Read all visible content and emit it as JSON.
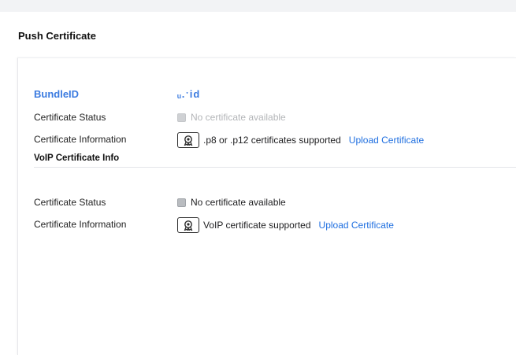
{
  "page": {
    "title": "Push Certificate"
  },
  "push": {
    "bundle_label": "BundleID",
    "bundle_value": "ᵤ.ˑid",
    "status_label": "Certificate Status",
    "status_value": "No certificate available",
    "info_label": "Certificate Information",
    "info_text": ".p8 or .p12 certificates supported",
    "upload_label": "Upload Certificate"
  },
  "voip": {
    "section_title": "VoIP Certificate Info",
    "status_label": "Certificate Status",
    "status_value": "No certificate available",
    "info_label": "Certificate Information",
    "info_text": "VoIP certificate supported",
    "upload_label": "Upload Certificate"
  },
  "icons": {
    "status": "status-square-icon",
    "certificate": "certificate-ribbon-icon"
  },
  "colors": {
    "accent": "#1f6fe0",
    "bundle": "#3b7be0",
    "disabled_text": "#b3b5b8"
  }
}
